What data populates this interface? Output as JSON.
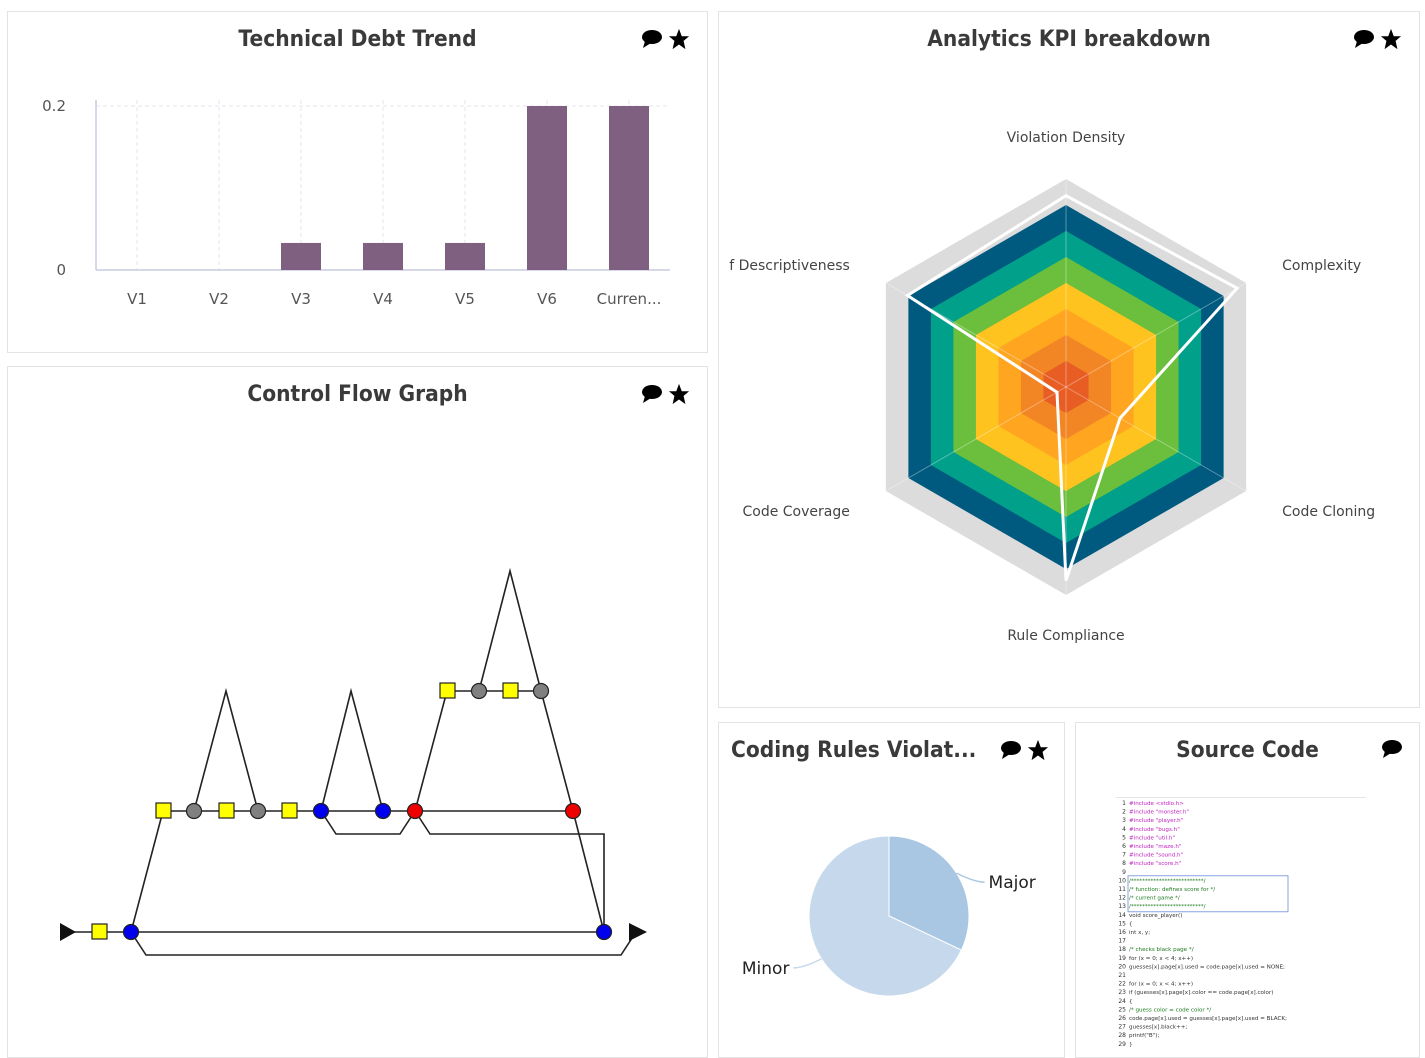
{
  "panels": {
    "tech_debt": {
      "title": "Technical Debt Trend",
      "icons": [
        "comment-icon",
        "star-icon"
      ]
    },
    "kpi": {
      "title": "Analytics KPI breakdown",
      "icons": [
        "comment-icon",
        "star-icon"
      ]
    },
    "cfg": {
      "title": "Control Flow Graph",
      "icons": [
        "comment-icon",
        "star-icon"
      ]
    },
    "rules": {
      "title": "Coding Rules Violat...",
      "icons": [
        "comment-icon",
        "star-icon"
      ]
    },
    "source": {
      "title": "Source Code",
      "icons": [
        "comment-icon"
      ]
    }
  },
  "colors": {
    "bar": "#806080",
    "radar_bands": [
      "#dcdcdc",
      "#005a80",
      "#00a08a",
      "#6cbf3c",
      "#ffc320",
      "#ffa51f",
      "#f28524",
      "#e75d24"
    ],
    "pie_major": "#a9c7e3",
    "pie_minor": "#c6d8ec",
    "node_yellow": "#ffff00",
    "node_gray": "#808080",
    "node_blue": "#0000ee",
    "node_red": "#ee0000"
  },
  "chart_data": [
    {
      "type": "bar",
      "title": "Technical Debt Trend",
      "categories": [
        "V1",
        "V2",
        "V3",
        "V4",
        "V5",
        "V6",
        "Curren..."
      ],
      "values": [
        0,
        0,
        0.033,
        0.033,
        0.033,
        0.2,
        0.2
      ],
      "ylim": [
        0,
        0.2
      ],
      "yticks": [
        "0",
        "0.2"
      ],
      "grid": true
    },
    {
      "type": "radar",
      "title": "Analytics KPI breakdown",
      "axes": [
        "Violation Density",
        "Complexity",
        "Code Cloning",
        "Rule Compliance",
        "Code Coverage",
        "f Descriptiveness"
      ],
      "bands": 8,
      "max": 1.0,
      "values": [
        0.92,
        0.95,
        0.3,
        0.93,
        0.05,
        0.88
      ]
    },
    {
      "type": "pie",
      "title": "Coding Rules Violat...",
      "slices": [
        {
          "label": "Major",
          "value": 32
        },
        {
          "label": "Minor",
          "value": 68
        }
      ]
    }
  ],
  "source_code": {
    "lines": [
      "#include <stdio.h>",
      "#include \"monster.h\"",
      "#include \"player.h\"",
      "#include \"bugs.h\"",
      "#include \"util.h\"",
      "#include \"maze.h\"",
      "#include \"sound.h\"",
      "#include \"score.h\"",
      "",
      "/**************************/",
      "/* function: defines score for   */",
      "/*           current game         */",
      "/**************************/",
      "void score_player()",
      "{",
      "   int x, y;",
      "",
      "   /* checks black page */",
      "   for (x = 0; x < 4; x++)",
      "     guesses[x].page[x].used = code.page[x].used = NONE;",
      "",
      "   for (x = 0; x < 4; x++)",
      "     if (guesses[x].page[x].color == code.page[x].color)",
      "     {",
      "        /* guess color = code color */",
      "        code.page[x].used = guesses[x].page[x].used = BLACK;",
      "        guesses[x].black++;",
      "        printf(\"B\");",
      "     }"
    ]
  }
}
